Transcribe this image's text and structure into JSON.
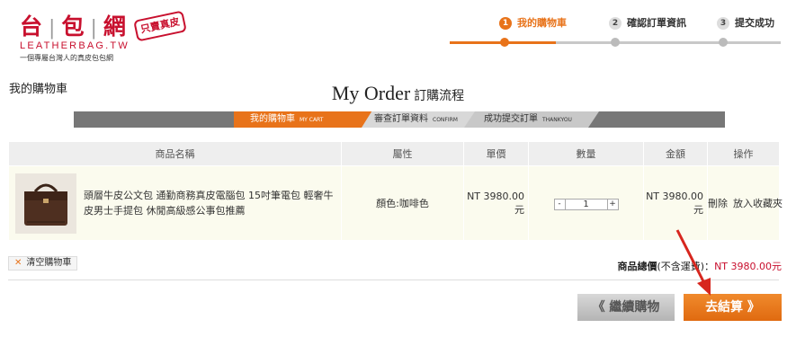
{
  "logo": {
    "main": [
      "台",
      "包",
      "網"
    ],
    "en": "LEATHERBAG.TW",
    "sub": "一個專屬台灣人的真皮包包網",
    "stamp": "只賣真皮"
  },
  "steps": [
    {
      "num": "1",
      "label": "我的購物車",
      "active": true
    },
    {
      "num": "2",
      "label": "確認訂單資訊",
      "active": false
    },
    {
      "num": "3",
      "label": "提交成功",
      "active": false
    }
  ],
  "page": {
    "my_cart": "我的購物車",
    "title_en": "My Order",
    "title_zh": "訂購流程"
  },
  "process": [
    {
      "label": "我的購物車",
      "small": "MY CART"
    },
    {
      "label": "審查訂單資料",
      "small": "CONFIRM"
    },
    {
      "label": "成功提交訂單",
      "small": "THANKYOU"
    }
  ],
  "table": {
    "headers": [
      "商品名稱",
      "屬性",
      "單價",
      "數量",
      "金額",
      "操作"
    ],
    "rows": [
      {
        "name": "頭層牛皮公文包 通勤商務真皮電腦包 15吋筆電包 輕奢牛皮男士手提包 休閒高級感公事包推薦",
        "attribute": "顏色:咖啡色",
        "price": "NT 3980.00元",
        "qty": "1",
        "amount": "NT 3980.00元",
        "delete": "刪除",
        "favorite": "放入收藏夾"
      }
    ]
  },
  "qty_minus": "-",
  "qty_plus": "+",
  "clear_cart": "清空購物車",
  "total": {
    "label": "商品總價",
    "note": "(不含運費)：",
    "amount": "NT 3980.00元"
  },
  "buttons": {
    "continue": "《 繼續購物",
    "checkout": "去結算 》"
  },
  "colors": {
    "accent": "#e8731a",
    "brand": "#c8102e"
  }
}
